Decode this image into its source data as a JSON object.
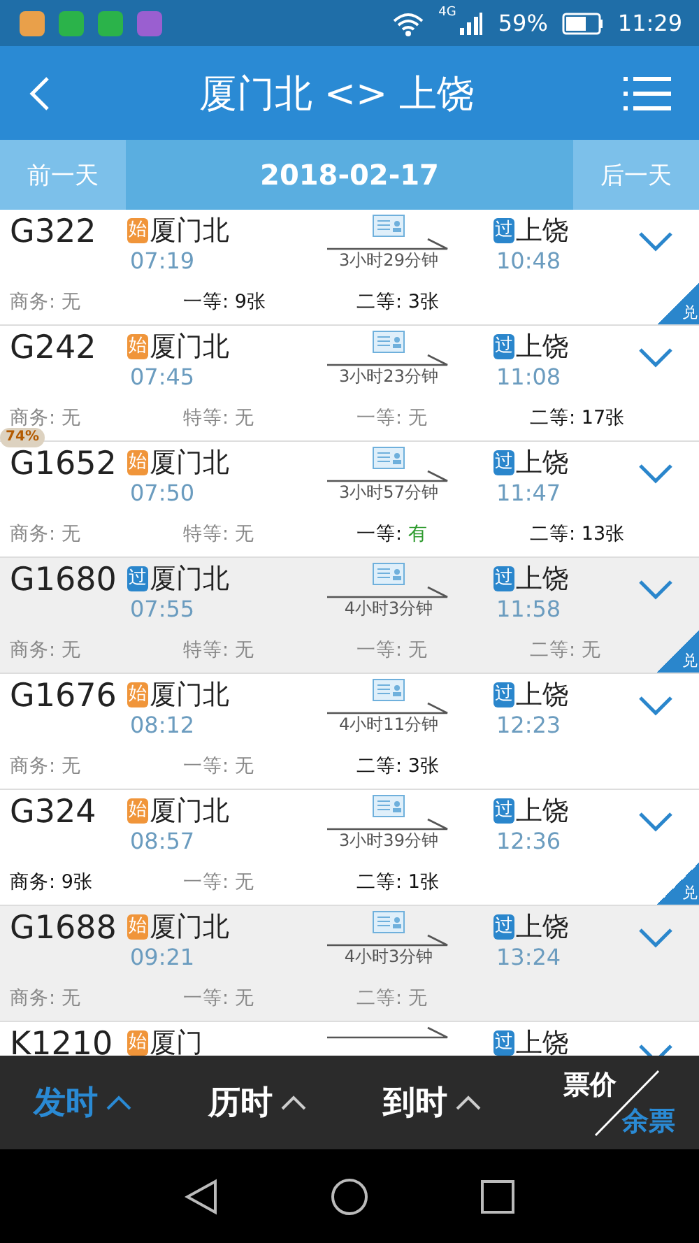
{
  "status_bar": {
    "battery": "59%",
    "time": "11:29",
    "network": "4G"
  },
  "header": {
    "title": "厦门北 <> 上饶"
  },
  "date_bar": {
    "prev": "前一天",
    "date": "2018-02-17",
    "next": "后一天"
  },
  "trains": [
    {
      "number": "G322",
      "origin_tag": {
        "text": "始",
        "kind": "start"
      },
      "origin": "厦门北",
      "depart": "07:19",
      "duration": "3小时29分钟",
      "dest_tag": {
        "text": "过",
        "kind": "pass"
      },
      "dest": "上饶",
      "arrive": "10:48",
      "sold_out": false,
      "badge": "兑",
      "seats": [
        {
          "label": "商务:",
          "value": "无",
          "kind": "none"
        },
        {
          "label": "一等:",
          "value": "9张",
          "kind": "count"
        },
        {
          "label": "二等:",
          "value": "3张",
          "kind": "count"
        }
      ]
    },
    {
      "number": "G242",
      "origin_tag": {
        "text": "始",
        "kind": "start"
      },
      "origin": "厦门北",
      "depart": "07:45",
      "duration": "3小时23分钟",
      "dest_tag": {
        "text": "过",
        "kind": "pass"
      },
      "dest": "上饶",
      "arrive": "11:08",
      "sold_out": false,
      "seats": [
        {
          "label": "商务:",
          "value": "无",
          "kind": "none"
        },
        {
          "label": "特等:",
          "value": "无",
          "kind": "none"
        },
        {
          "label": "一等:",
          "value": "无",
          "kind": "none"
        },
        {
          "label": "二等:",
          "value": "17张",
          "kind": "count"
        }
      ]
    },
    {
      "number": "G1652",
      "origin_tag": {
        "text": "始",
        "kind": "start"
      },
      "origin": "厦门北",
      "depart": "07:50",
      "duration": "3小时57分钟",
      "dest_tag": {
        "text": "过",
        "kind": "pass"
      },
      "dest": "上饶",
      "arrive": "11:47",
      "sold_out": false,
      "seats": [
        {
          "label": "商务:",
          "value": "无",
          "kind": "none"
        },
        {
          "label": "特等:",
          "value": "无",
          "kind": "none"
        },
        {
          "label": "一等:",
          "value": "有",
          "kind": "plenty"
        },
        {
          "label": "二等:",
          "value": "13张",
          "kind": "count"
        }
      ]
    },
    {
      "number": "G1680",
      "origin_tag": {
        "text": "过",
        "kind": "pass"
      },
      "origin": "厦门北",
      "depart": "07:55",
      "duration": "4小时3分钟",
      "dest_tag": {
        "text": "过",
        "kind": "pass"
      },
      "dest": "上饶",
      "arrive": "11:58",
      "sold_out": true,
      "badge": "兑",
      "seats": [
        {
          "label": "商务:",
          "value": "无",
          "kind": "none"
        },
        {
          "label": "特等:",
          "value": "无",
          "kind": "none"
        },
        {
          "label": "一等:",
          "value": "无",
          "kind": "none"
        },
        {
          "label": "二等:",
          "value": "无",
          "kind": "none"
        }
      ]
    },
    {
      "number": "G1676",
      "origin_tag": {
        "text": "始",
        "kind": "start"
      },
      "origin": "厦门北",
      "depart": "08:12",
      "duration": "4小时11分钟",
      "dest_tag": {
        "text": "过",
        "kind": "pass"
      },
      "dest": "上饶",
      "arrive": "12:23",
      "sold_out": false,
      "seats": [
        {
          "label": "商务:",
          "value": "无",
          "kind": "none"
        },
        {
          "label": "一等:",
          "value": "无",
          "kind": "none"
        },
        {
          "label": "二等:",
          "value": "3张",
          "kind": "count"
        }
      ]
    },
    {
      "number": "G324",
      "origin_tag": {
        "text": "始",
        "kind": "start"
      },
      "origin": "厦门北",
      "depart": "08:57",
      "duration": "3小时39分钟",
      "dest_tag": {
        "text": "过",
        "kind": "pass"
      },
      "dest": "上饶",
      "arrive": "12:36",
      "sold_out": false,
      "badge": "兑",
      "seats": [
        {
          "label": "商务:",
          "value": "9张",
          "kind": "count"
        },
        {
          "label": "一等:",
          "value": "无",
          "kind": "none"
        },
        {
          "label": "二等:",
          "value": "1张",
          "kind": "count"
        }
      ]
    },
    {
      "number": "G1688",
      "origin_tag": {
        "text": "始",
        "kind": "start"
      },
      "origin": "厦门北",
      "depart": "09:21",
      "duration": "4小时3分钟",
      "dest_tag": {
        "text": "过",
        "kind": "pass"
      },
      "dest": "上饶",
      "arrive": "13:24",
      "sold_out": true,
      "seats": [
        {
          "label": "商务:",
          "value": "无",
          "kind": "none"
        },
        {
          "label": "一等:",
          "value": "无",
          "kind": "none"
        },
        {
          "label": "二等:",
          "value": "无",
          "kind": "none"
        }
      ]
    },
    {
      "number": "K1210",
      "origin_tag": {
        "text": "始",
        "kind": "start"
      },
      "origin": "厦门",
      "dest_tag": {
        "text": "过",
        "kind": "pass"
      },
      "dest": "上饶",
      "sold_out": false
    }
  ],
  "floating_widget": {
    "text": "74%"
  },
  "sort_bar": {
    "items": [
      {
        "label": "发时",
        "selected": true
      },
      {
        "label": "历时",
        "selected": false
      },
      {
        "label": "到时",
        "selected": false
      }
    ],
    "toggle": [
      {
        "label": "票价",
        "selected": false
      },
      {
        "label": "余票",
        "selected": true
      }
    ]
  }
}
